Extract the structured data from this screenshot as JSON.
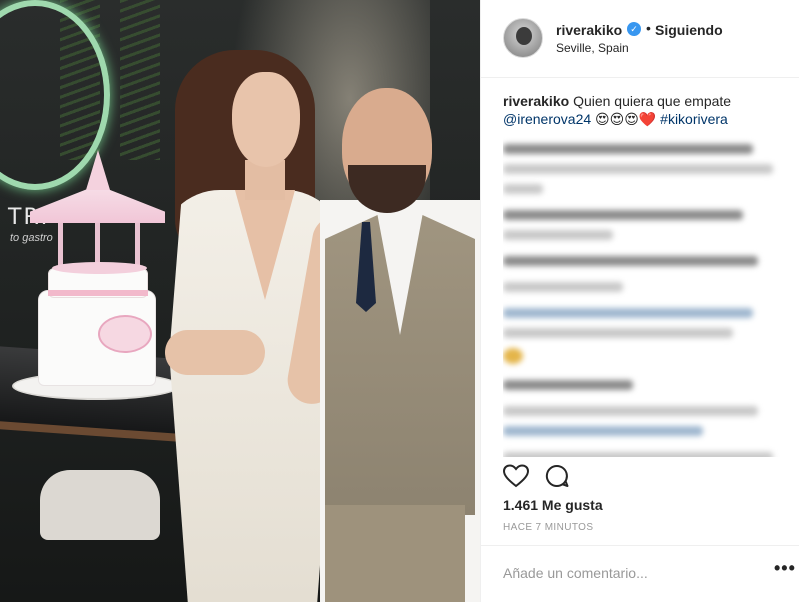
{
  "post": {
    "username": "riverakiko",
    "verified_glyph": "✓",
    "separator": "•",
    "follow_status": "Siguiendo",
    "location": "Seville, Spain"
  },
  "photo": {
    "sign_text": "TRI",
    "sign_sub": "to gastro"
  },
  "caption": {
    "username": "riverakiko",
    "text": "Quien quiera que empate",
    "mention": "@irenerova24",
    "emojis": "😍😍😍❤️",
    "hashtag": "#kikorivera"
  },
  "blurred_comment_count": 9,
  "engagement": {
    "likes": "1.461 Me gusta",
    "time": "HACE 7 MINUTOS"
  },
  "comment_box": {
    "placeholder": "Añade un comentario...",
    "more_glyph": "•••"
  },
  "icons": [
    "heart-icon",
    "comment-icon",
    "verified-badge-icon",
    "more-options-icon"
  ],
  "colors": {
    "verified": "#3897f0",
    "link": "#003569",
    "muted": "#999999",
    "text": "#262626",
    "border": "#efefef"
  }
}
